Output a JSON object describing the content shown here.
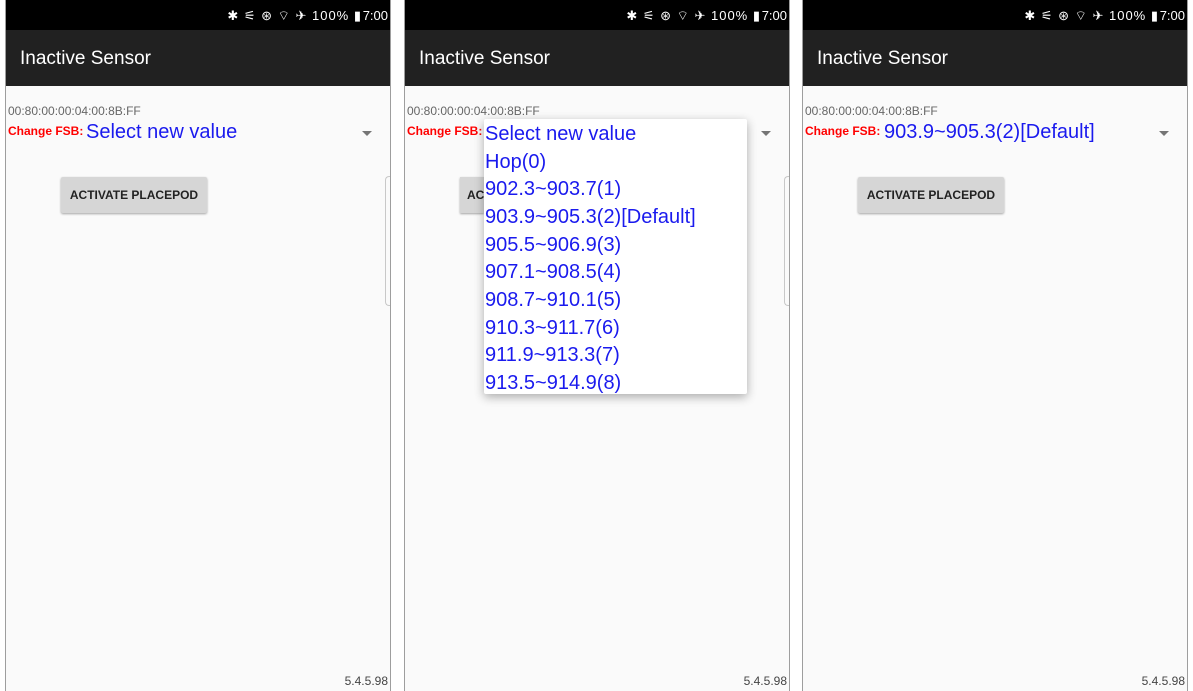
{
  "status": {
    "icons": "✱ ⚟ ⊛ ⌔ ✈",
    "battery": "100% ▮",
    "time": "7:00"
  },
  "app_title": "Inactive Sensor",
  "device_id": "00:80:00:00:04:00:8B:FF",
  "fsb_label": "Change FSB:",
  "activate_button": "ACTIVATE PLACEPOD",
  "activate_button_partial": "AC",
  "version": "5.4.5.98",
  "screens": [
    {
      "selected_value": "Select new value"
    },
    {
      "selected_value": "Select new value"
    },
    {
      "selected_value": "903.9~905.3(2)[Default]"
    }
  ],
  "fsb_options": [
    "Select new value",
    "Hop(0)",
    "902.3~903.7(1)",
    "903.9~905.3(2)[Default]",
    "905.5~906.9(3)",
    "907.1~908.5(4)",
    "908.7~910.1(5)",
    "910.3~911.7(6)",
    "911.9~913.3(7)",
    "913.5~914.9(8)"
  ],
  "colors": {
    "fsb_label": "#ff0000",
    "spinner_text": "#1a1aee",
    "appbar": "#212121"
  }
}
